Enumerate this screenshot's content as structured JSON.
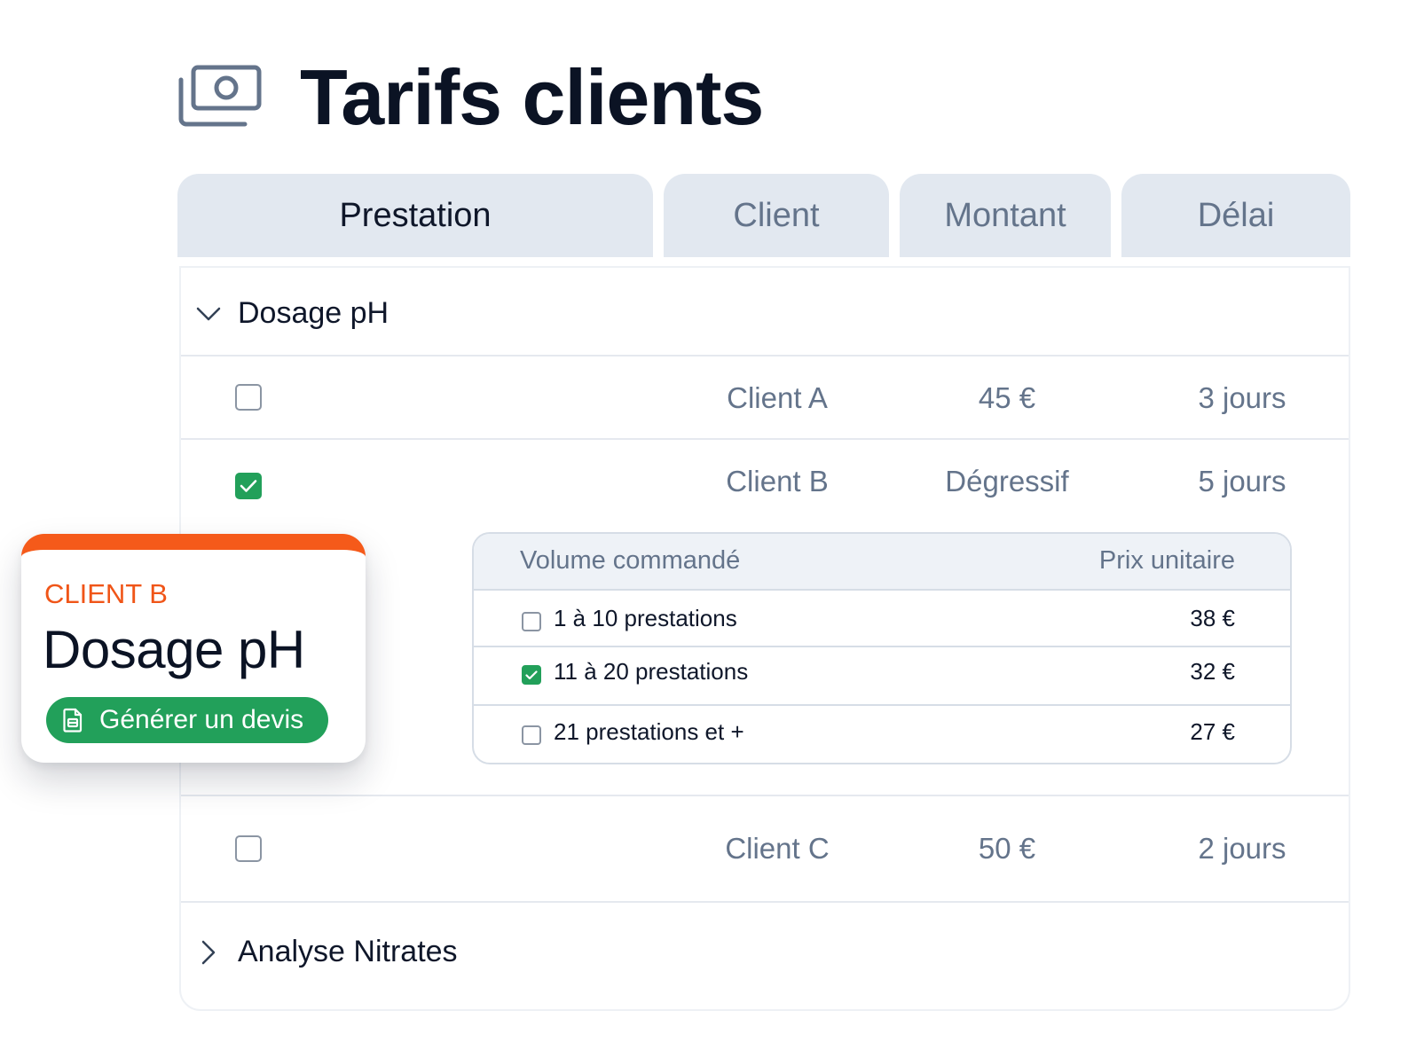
{
  "page": {
    "title": "Tarifs clients",
    "title_icon": "money-bills-icon"
  },
  "columns": {
    "prestation": "Prestation",
    "client": "Client",
    "montant": "Montant",
    "delai": "Délai"
  },
  "groups": [
    {
      "label": "Dosage pH",
      "expanded": true,
      "rows": [
        {
          "checked": false,
          "client": "Client A",
          "montant": "45 €",
          "delai": "3 jours"
        },
        {
          "checked": true,
          "client": "Client B",
          "montant": "Dégressif",
          "delai": "5 jours",
          "tiers": {
            "header_volume": "Volume commandé",
            "header_price": "Prix unitaire",
            "items": [
              {
                "checked": false,
                "label": "1 à 10 prestations",
                "price": "38 €"
              },
              {
                "checked": true,
                "label": "11 à 20 prestations",
                "price": "32 €"
              },
              {
                "checked": false,
                "label": "21 prestations et +",
                "price": "27 €"
              }
            ]
          }
        },
        {
          "checked": false,
          "client": "Client C",
          "montant": "50 €",
          "delai": "2 jours"
        }
      ]
    },
    {
      "label": "Analyse Nitrates",
      "expanded": false
    }
  ],
  "floating_card": {
    "client": "CLIENT B",
    "title": "Dosage pH",
    "button_label": "Générer un devis",
    "button_icon": "document-icon"
  },
  "colors": {
    "accent_green": "#22a05a",
    "accent_orange": "#f55a1a",
    "header_bg": "#e2e8f0"
  }
}
